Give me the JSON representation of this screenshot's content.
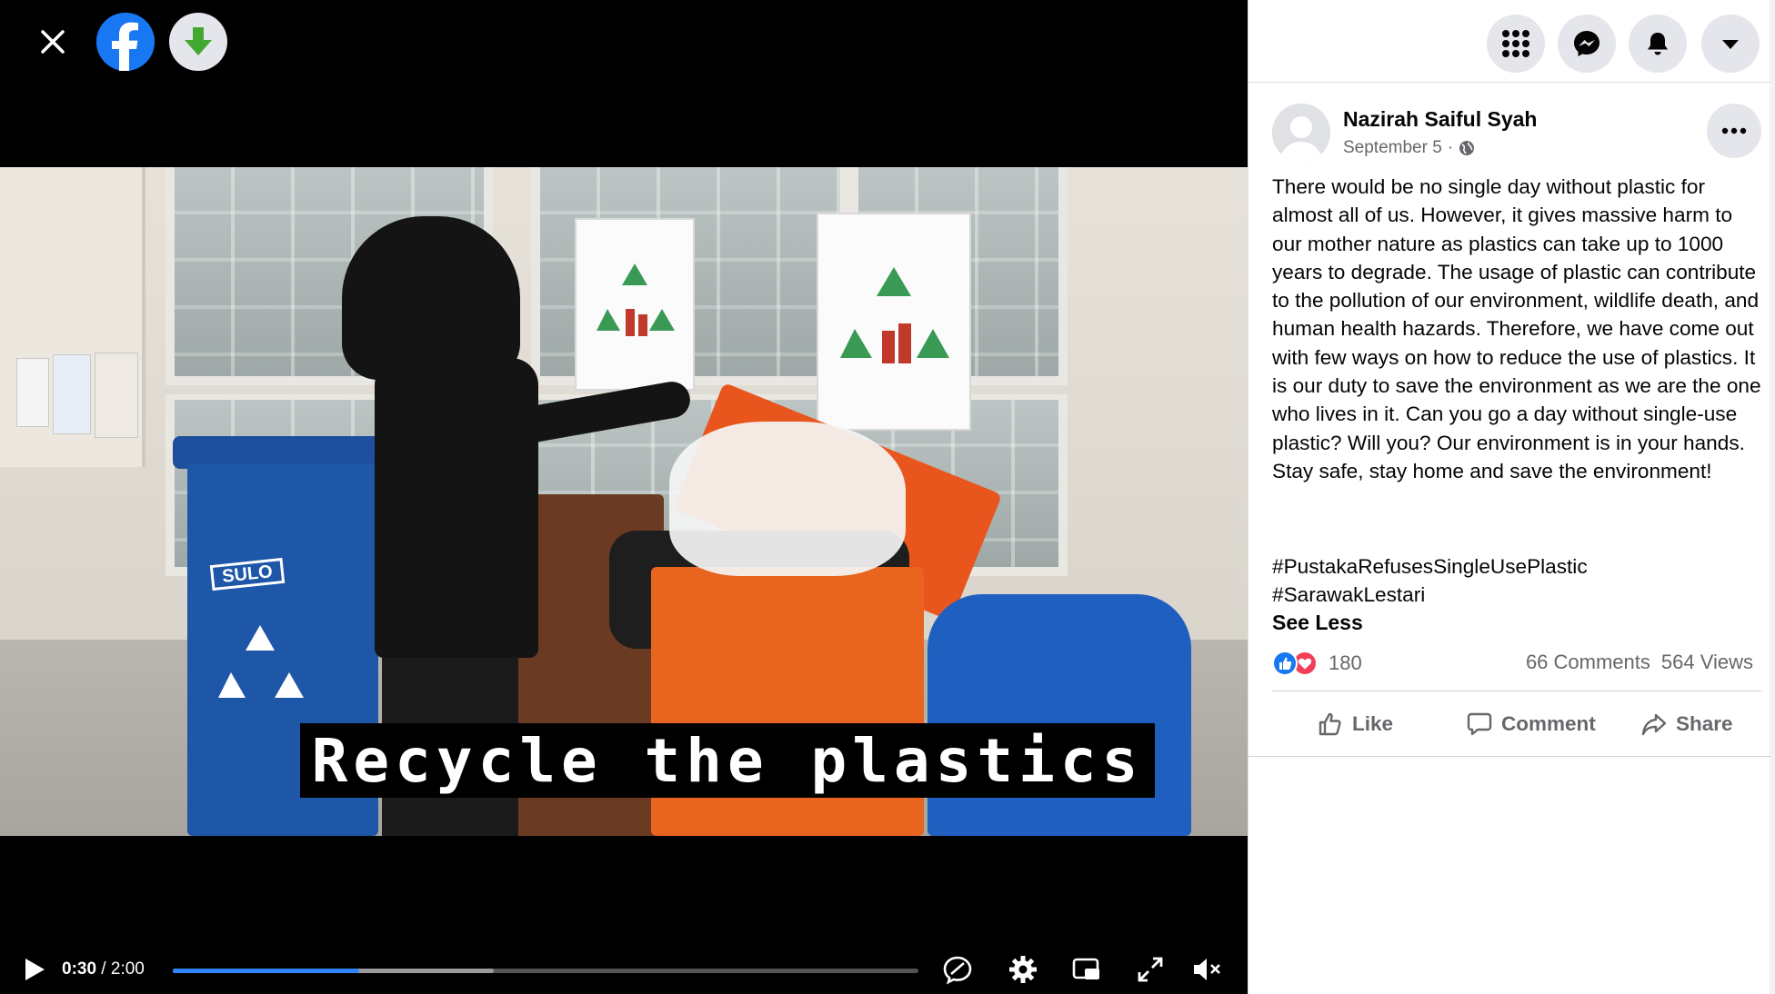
{
  "video": {
    "caption": "Recycle the plastics",
    "current_time": "0:30",
    "separator": " / ",
    "duration": "2:00",
    "progress": 0.25,
    "buffered": 0.43,
    "bin_label": "SULO",
    "accent_color": "#2d88ff"
  },
  "viewer_toolbar": {
    "close_icon": "close-icon",
    "logo_icon": "facebook-logo-icon",
    "download_icon": "download-arrow-icon"
  },
  "nav": {
    "icons": [
      "menu-grid-icon",
      "messenger-icon",
      "bell-icon",
      "caret-down-icon"
    ]
  },
  "post": {
    "author": "Nazirah Saiful Syah",
    "date": "September 5",
    "dot": "·",
    "privacy_icon": "globe-icon",
    "text": "There would be no single day without plastic for almost all of us. However, it gives massive harm to our mother nature as plastics can take up to 1000 years to degrade. The usage of plastic can contribute to the pollution of our environment, wildlife death, and human health hazards. Therefore, we have come out with few ways on how to reduce the use of plastics. It is our duty to save the environment as we are the one who lives in it. Can you go a day without single-use plastic? Will you? Our environment is in your hands. Stay safe, stay home and save the environment!",
    "hashtags": [
      "#PustakaRefusesSingleUsePlastic",
      "#SarawakLestari"
    ],
    "see_less": "See Less",
    "reaction_count": "180",
    "comments": "66 Comments",
    "views": "564 Views",
    "actions": {
      "like": "Like",
      "comment": "Comment",
      "share": "Share"
    },
    "colors": {
      "like_blue": "#1877f2",
      "love_red": "#f33e58"
    }
  }
}
